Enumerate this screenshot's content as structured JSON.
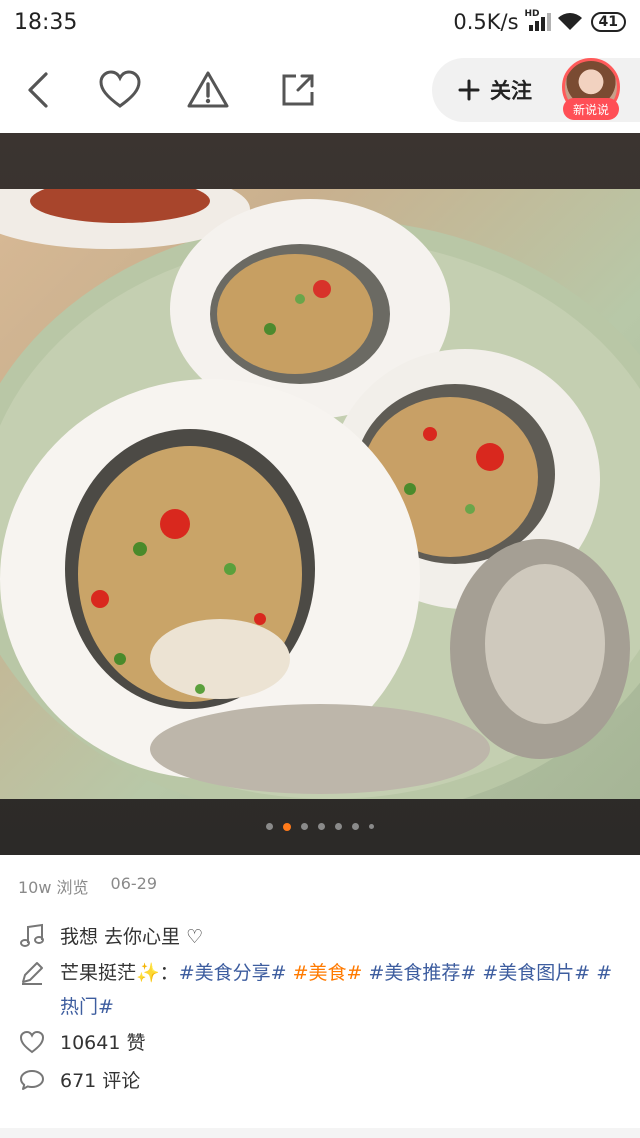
{
  "status": {
    "time": "18:35",
    "network_speed": "0.5K/s",
    "signal_label": "HD",
    "battery": "41"
  },
  "nav": {
    "back_icon": "back-chevron-icon",
    "like_icon": "heart-icon",
    "report_icon": "warning-triangle-icon",
    "share_icon": "share-icon",
    "follow_label": "关注",
    "avatar_badge": "新说说"
  },
  "gallery": {
    "page_count": 7,
    "active_index": 1,
    "accent": "#ff7a1a"
  },
  "post": {
    "views": "10w 浏览",
    "date": "06-29",
    "music_title": "我想  去你心里 ♡",
    "author": "芒果挺茫",
    "author_suffix": "✨：",
    "tags": [
      {
        "text": "#美食分享#",
        "hot": false
      },
      {
        "text": "#美食#",
        "hot": true
      },
      {
        "text": "#美食推荐#",
        "hot": false
      },
      {
        "text": "#美食图片#",
        "hot": false
      },
      {
        "text": "#热门#",
        "hot": false
      }
    ],
    "likes": "10641 赞",
    "comments": "671 评论"
  },
  "colors": {
    "tag_blue": "#3d5d9f",
    "tag_orange": "#ff7a00",
    "badge_red": "#ff4f56"
  }
}
